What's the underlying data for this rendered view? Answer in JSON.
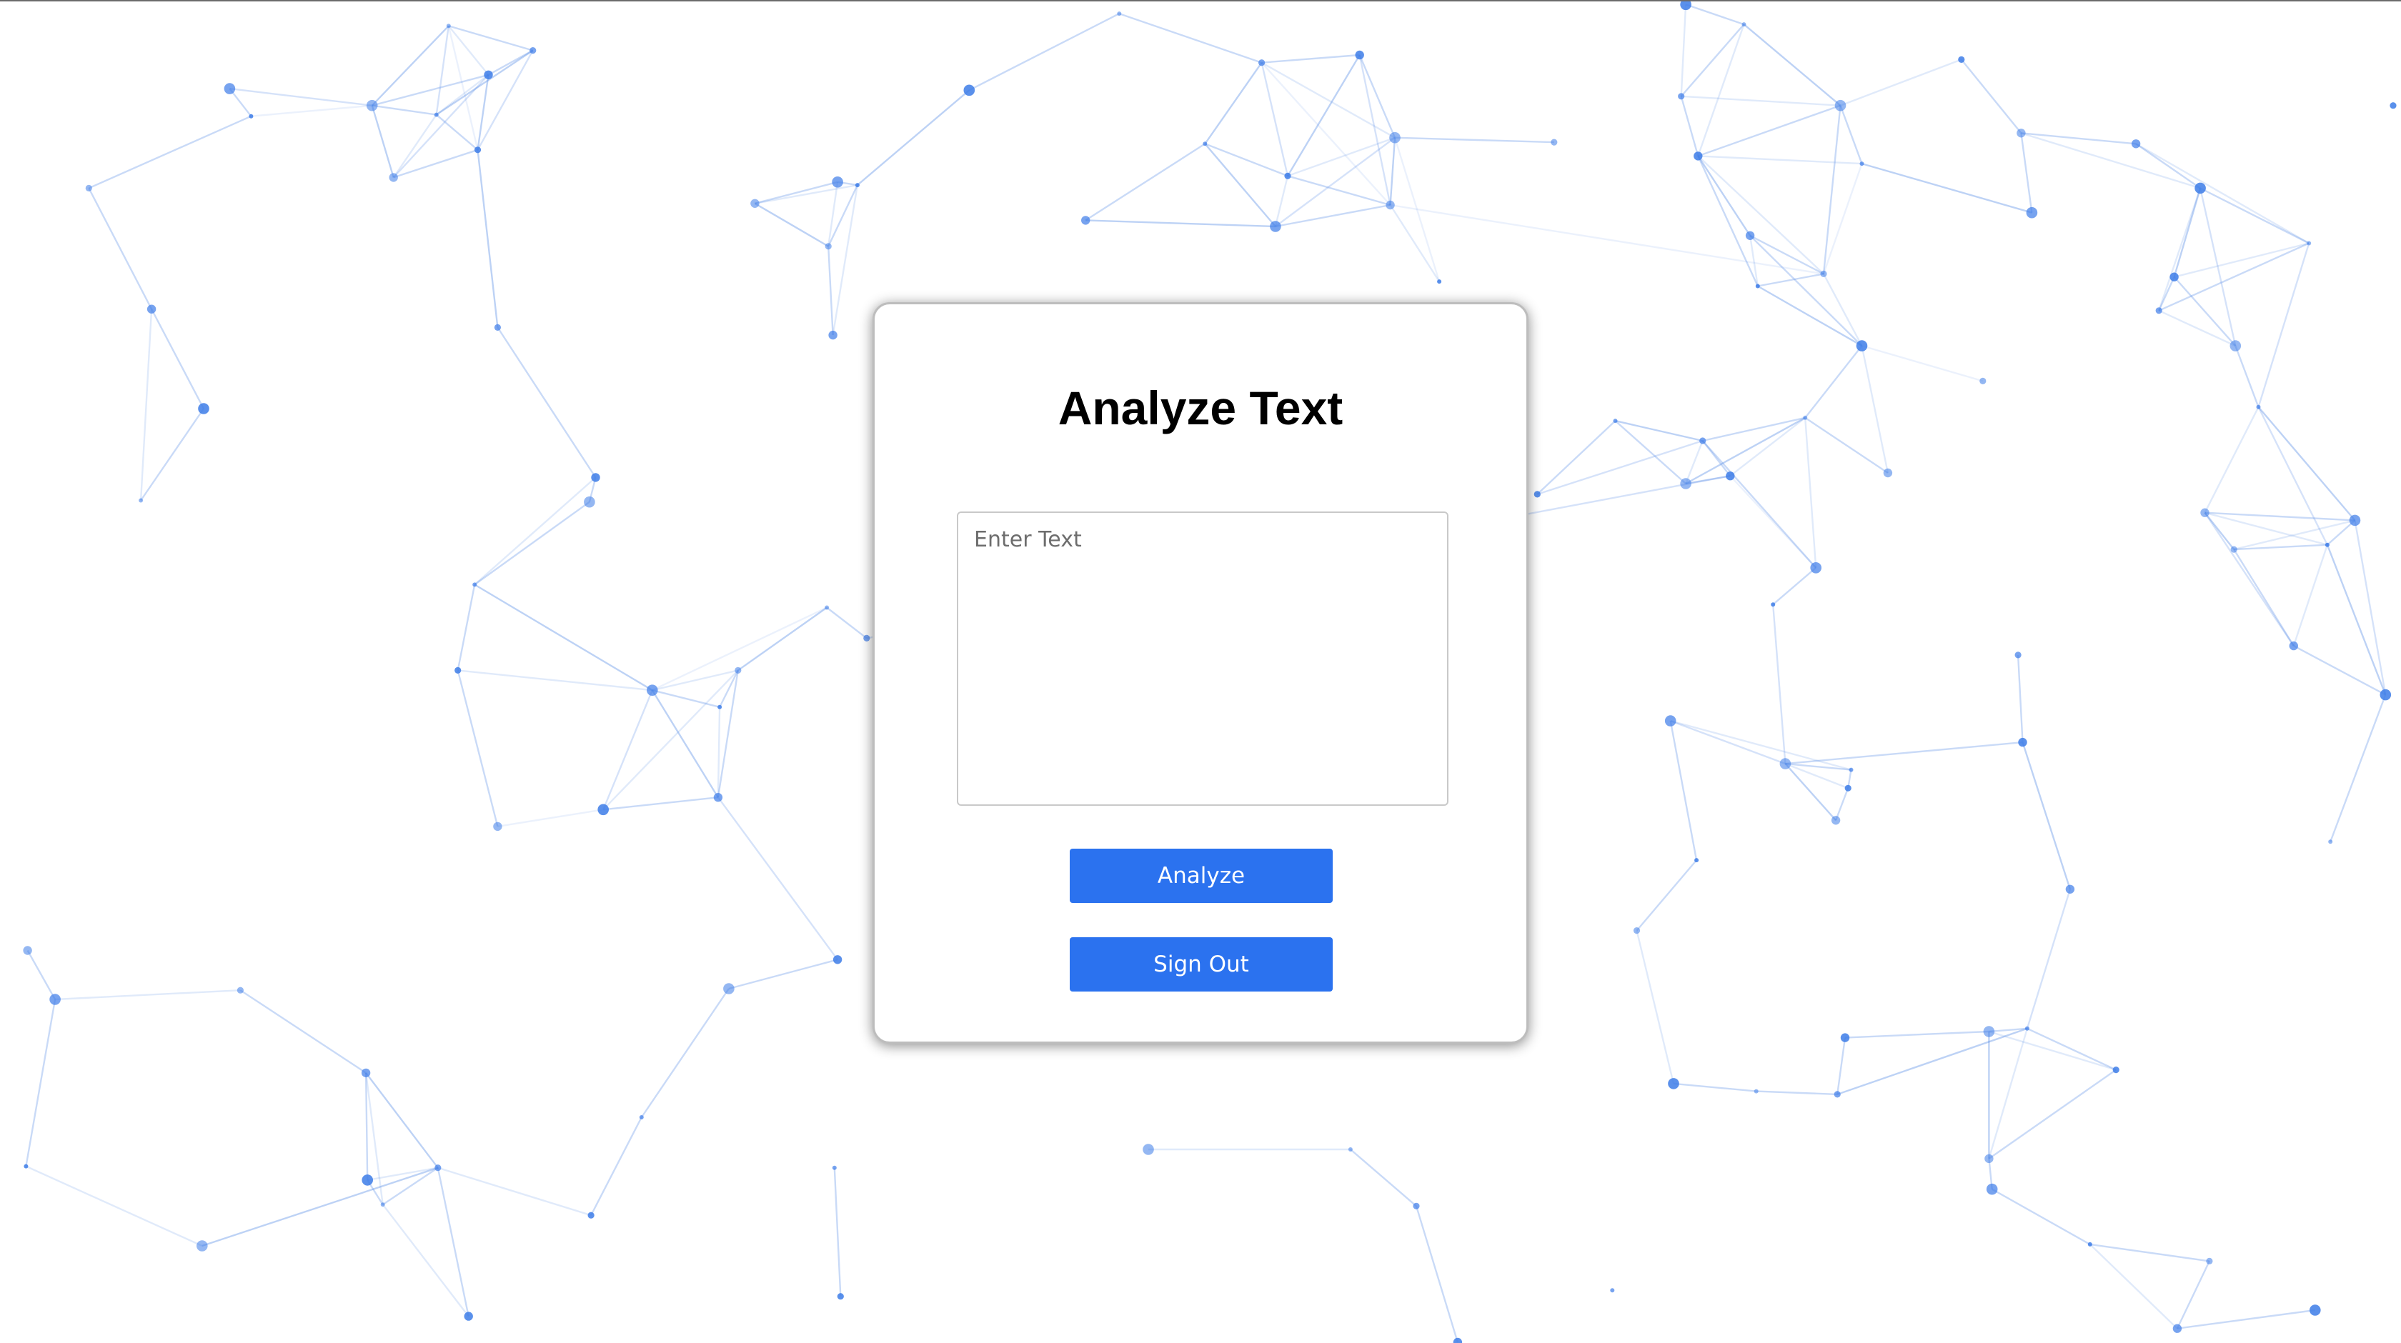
{
  "form": {
    "title": "Analyze Text",
    "text_input": {
      "value": "",
      "placeholder": "Enter Text"
    },
    "analyze_label": "Analyze",
    "signout_label": "Sign Out"
  },
  "colors": {
    "accent": "#2b72ef",
    "network_line": "#5b8fe6",
    "network_node": "#3d7ce8"
  }
}
